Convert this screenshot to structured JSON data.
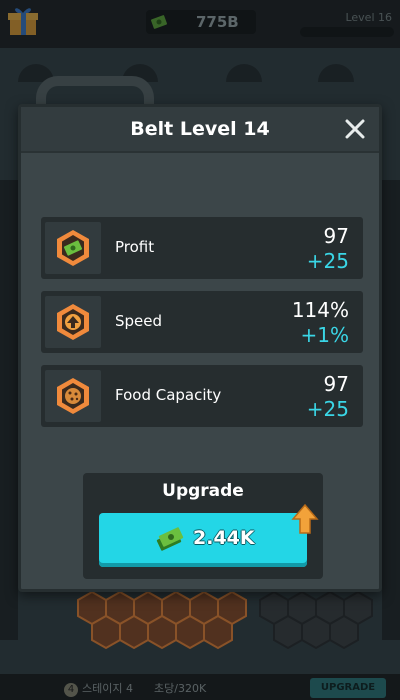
{
  "hud": {
    "money": "775B",
    "level": "Level 16"
  },
  "background": {
    "stage_number": "4",
    "stage_text": "스테이지 4",
    "per_second": "초당/320K",
    "upgrade_label": "UPGRADE"
  },
  "modal": {
    "title": "Belt Level 14",
    "stats": [
      {
        "label": "Profit",
        "value": "97",
        "bonus": "+25",
        "icon": "cash-icon"
      },
      {
        "label": "Speed",
        "value": "114%",
        "bonus": "+1%",
        "icon": "arrow-up-icon"
      },
      {
        "label": "Food Capacity",
        "value": "97",
        "bonus": "+25",
        "icon": "cookie-icon"
      }
    ],
    "upgrade": {
      "title": "Upgrade",
      "cost": "2.44K"
    }
  },
  "colors": {
    "accent_cyan": "#23d6e6",
    "bonus_text": "#3ad6e6",
    "hex_orange": "#f08a3c",
    "panel_bg": "#3c4649"
  }
}
